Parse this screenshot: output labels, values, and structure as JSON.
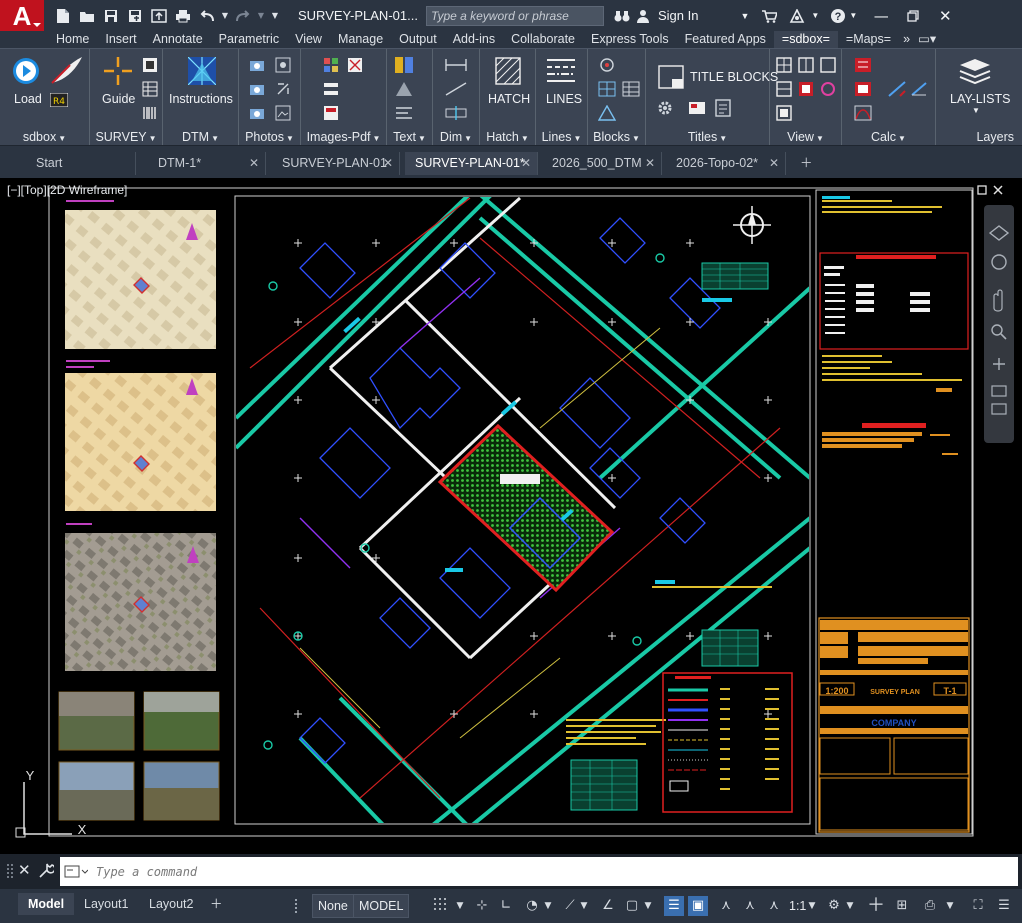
{
  "app": {
    "logo_letter": "A",
    "document_title": "SURVEY-PLAN-01...",
    "search_placeholder": "Type a keyword or phrase",
    "sign_in": "Sign In",
    "brand_color": "#c0121e"
  },
  "ribbon_tabs": [
    {
      "label": "Home"
    },
    {
      "label": "Insert"
    },
    {
      "label": "Annotate"
    },
    {
      "label": "Parametric"
    },
    {
      "label": "View"
    },
    {
      "label": "Manage"
    },
    {
      "label": "Output"
    },
    {
      "label": "Add-ins"
    },
    {
      "label": "Collaborate"
    },
    {
      "label": "Express Tools"
    },
    {
      "label": "Featured Apps"
    },
    {
      "label": "=sdbox="
    },
    {
      "label": "=Maps="
    }
  ],
  "ribbon": {
    "load_label": "Load",
    "guide_label": "Guide",
    "instructions_label": "Instructions",
    "hatch_label": "HATCH",
    "lines_label": "LINES",
    "title_blocks_label": "TITLE BLOCKS",
    "lay_lists_label": "LAY-LISTS",
    "groups": {
      "sdbox": "sdbox",
      "survey": "SURVEY",
      "dtm": "DTM",
      "photos": "Photos",
      "images_pdf": "Images-Pdf",
      "text": "Text",
      "dim": "Dim",
      "hatch": "Hatch",
      "lines": "Lines",
      "blocks": "Blocks",
      "titles": "Titles",
      "view": "View",
      "calc": "Calc",
      "layers": "Layers"
    }
  },
  "doc_tabs": [
    {
      "label": "Start",
      "closable": false
    },
    {
      "label": "DTM-1*",
      "closable": true
    },
    {
      "label": "SURVEY-PLAN-01",
      "closable": true
    },
    {
      "label": "SURVEY-PLAN-01*",
      "closable": true,
      "active": true
    },
    {
      "label": "2026_500_DTM",
      "closable": true
    },
    {
      "label": "2026-Topo-02*",
      "closable": true
    }
  ],
  "viewport_label": "[−][Top][2D Wireframe]",
  "drawing": {
    "scale_text": "1:200",
    "title_block_text": "SURVEY PLAN",
    "sheet_number": "T-1",
    "company_text": "COMPANY",
    "ucs_y": "Y",
    "ucs_x": "X"
  },
  "command_line": {
    "placeholder": "Type a command"
  },
  "layout_tabs": [
    {
      "label": "Model",
      "active": true
    },
    {
      "label": "Layout1"
    },
    {
      "label": "Layout2"
    }
  ],
  "status": {
    "none_label": "None",
    "model_label": "MODEL",
    "scale_label": "1:1"
  }
}
